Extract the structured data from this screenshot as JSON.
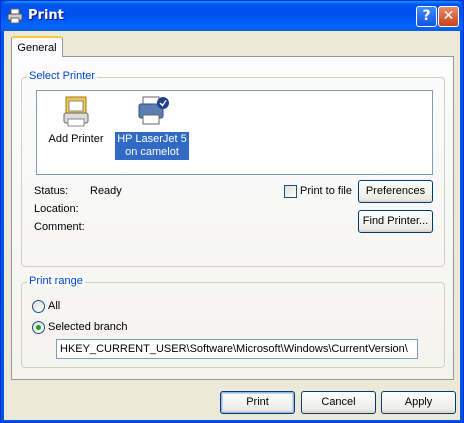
{
  "window": {
    "title": "Print"
  },
  "tabs": [
    {
      "label": "General"
    }
  ],
  "select_printer": {
    "legend": "Select Printer",
    "printers": [
      {
        "label": "Add Printer"
      },
      {
        "label_line1": "HP LaserJet 5",
        "label_line2": "on camelot",
        "selected": true
      }
    ],
    "status_label": "Status:",
    "status_value": "Ready",
    "location_label": "Location:",
    "comment_label": "Comment:",
    "print_to_file_label": "Print to file",
    "preferences_label": "Preferences",
    "find_printer_label": "Find Printer..."
  },
  "print_range": {
    "legend": "Print range",
    "all_label": "All",
    "selected_branch_label": "Selected branch",
    "selected_option": "Selected branch",
    "branch_path": "HKEY_CURRENT_USER\\Software\\Microsoft\\Windows\\CurrentVersion\\"
  },
  "footer": {
    "print_label": "Print",
    "cancel_label": "Cancel",
    "apply_label": "Apply"
  },
  "colors": {
    "titlebar": "#0054e3",
    "selection": "#316ac5",
    "group_legend": "#0046d5"
  }
}
